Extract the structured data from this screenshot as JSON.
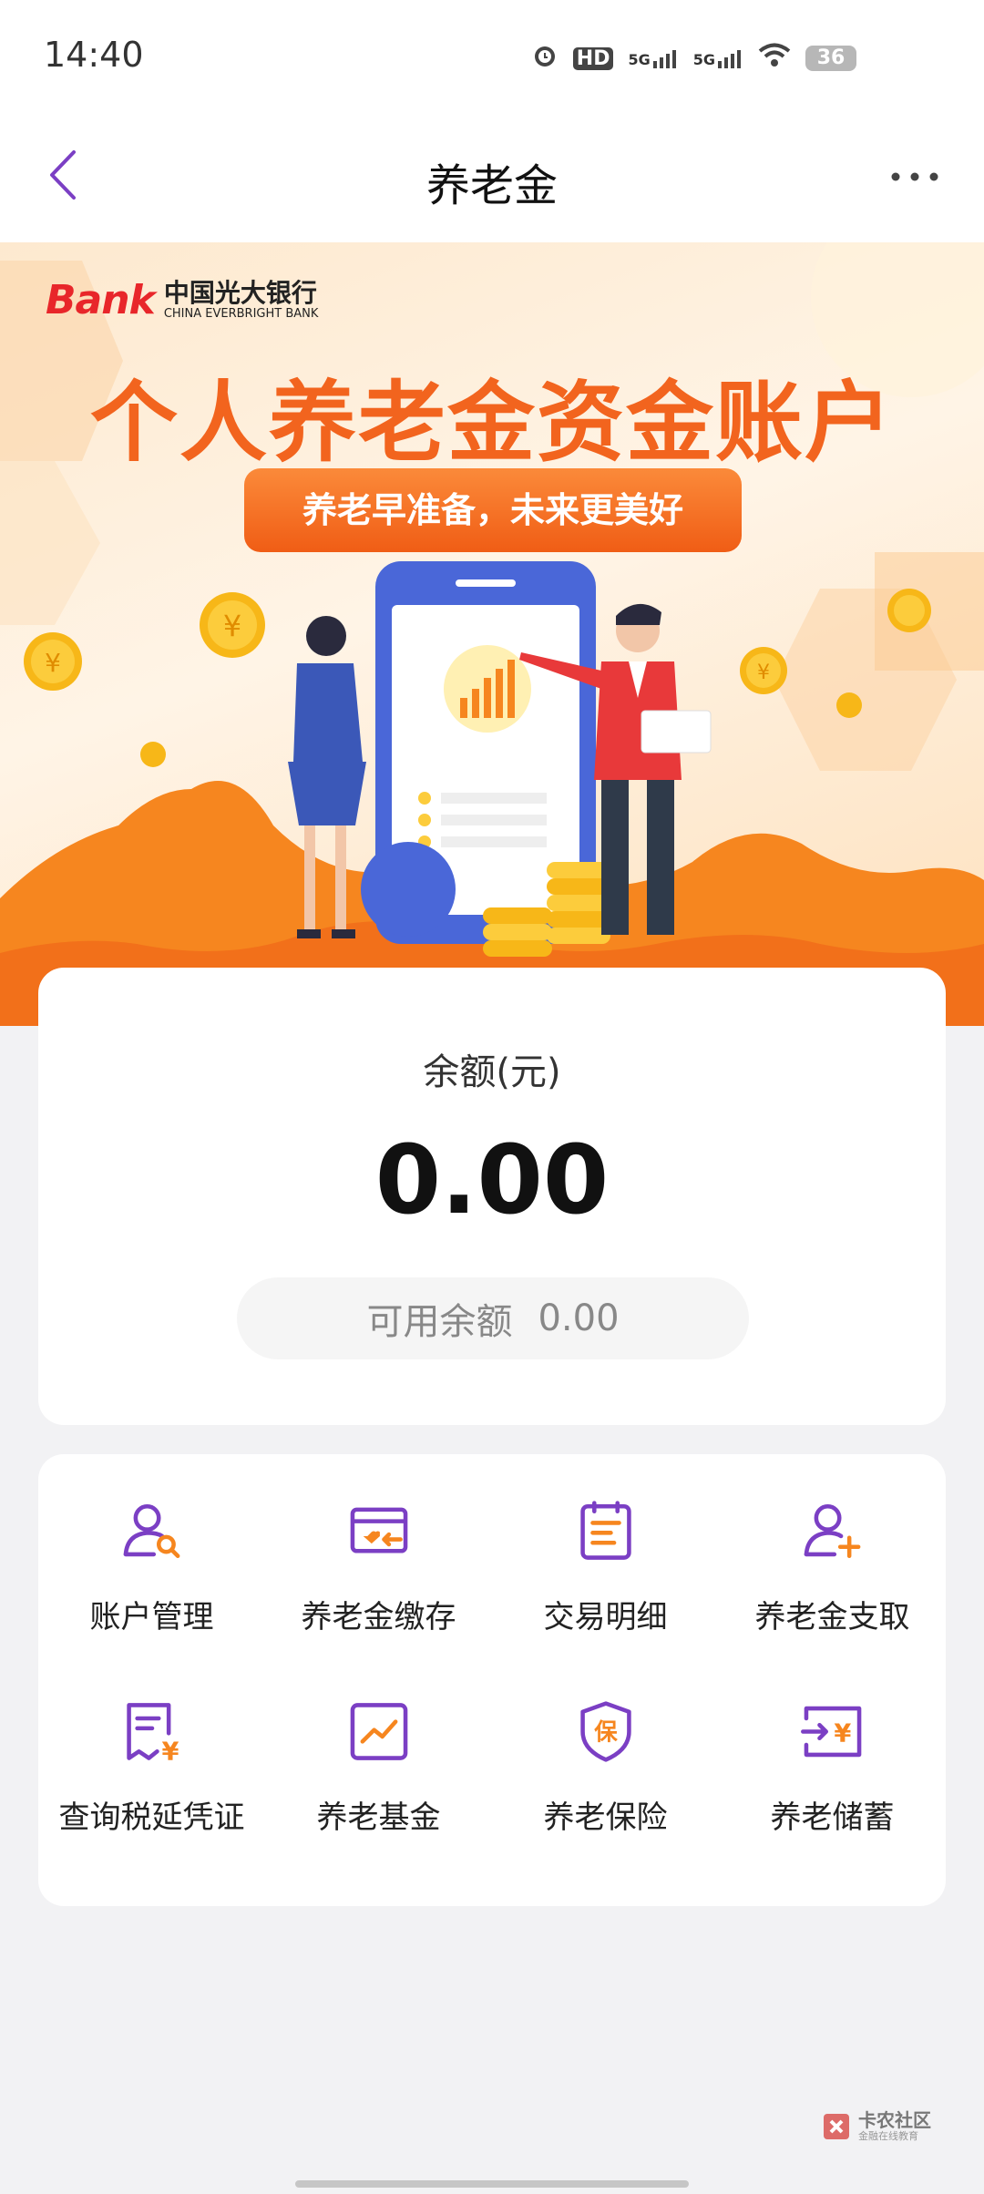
{
  "status_bar": {
    "time": "14:40",
    "hd": "HD",
    "net1": "5G",
    "net2": "5G",
    "battery": "36"
  },
  "nav": {
    "title": "养老金"
  },
  "banner": {
    "bank_word": "Bank",
    "bank_name_cn": "中国光大银行",
    "bank_name_en": "CHINA EVERBRIGHT BANK",
    "title": "个人养老金资金账户",
    "slogan": "养老早准备，未来更美好"
  },
  "balance": {
    "label": "余额(元)",
    "value": "0.00",
    "available_label": "可用余额",
    "available_value": "0.00"
  },
  "services": [
    {
      "label": "账户管理",
      "icon": "user-search-icon"
    },
    {
      "label": "养老金缴存",
      "icon": "card-deposit-icon"
    },
    {
      "label": "交易明细",
      "icon": "transaction-detail-icon"
    },
    {
      "label": "养老金支取",
      "icon": "user-add-icon"
    },
    {
      "label": "查询税延凭证",
      "icon": "tax-receipt-icon"
    },
    {
      "label": "养老基金",
      "icon": "fund-chart-icon"
    },
    {
      "label": "养老保险",
      "icon": "insurance-shield-icon"
    },
    {
      "label": "养老储蓄",
      "icon": "savings-transfer-icon"
    }
  ],
  "watermark": {
    "main": "卡农社区",
    "sub": "金融在线教育"
  },
  "colors": {
    "purple": "#7b3fc4",
    "orange": "#f2641e"
  }
}
